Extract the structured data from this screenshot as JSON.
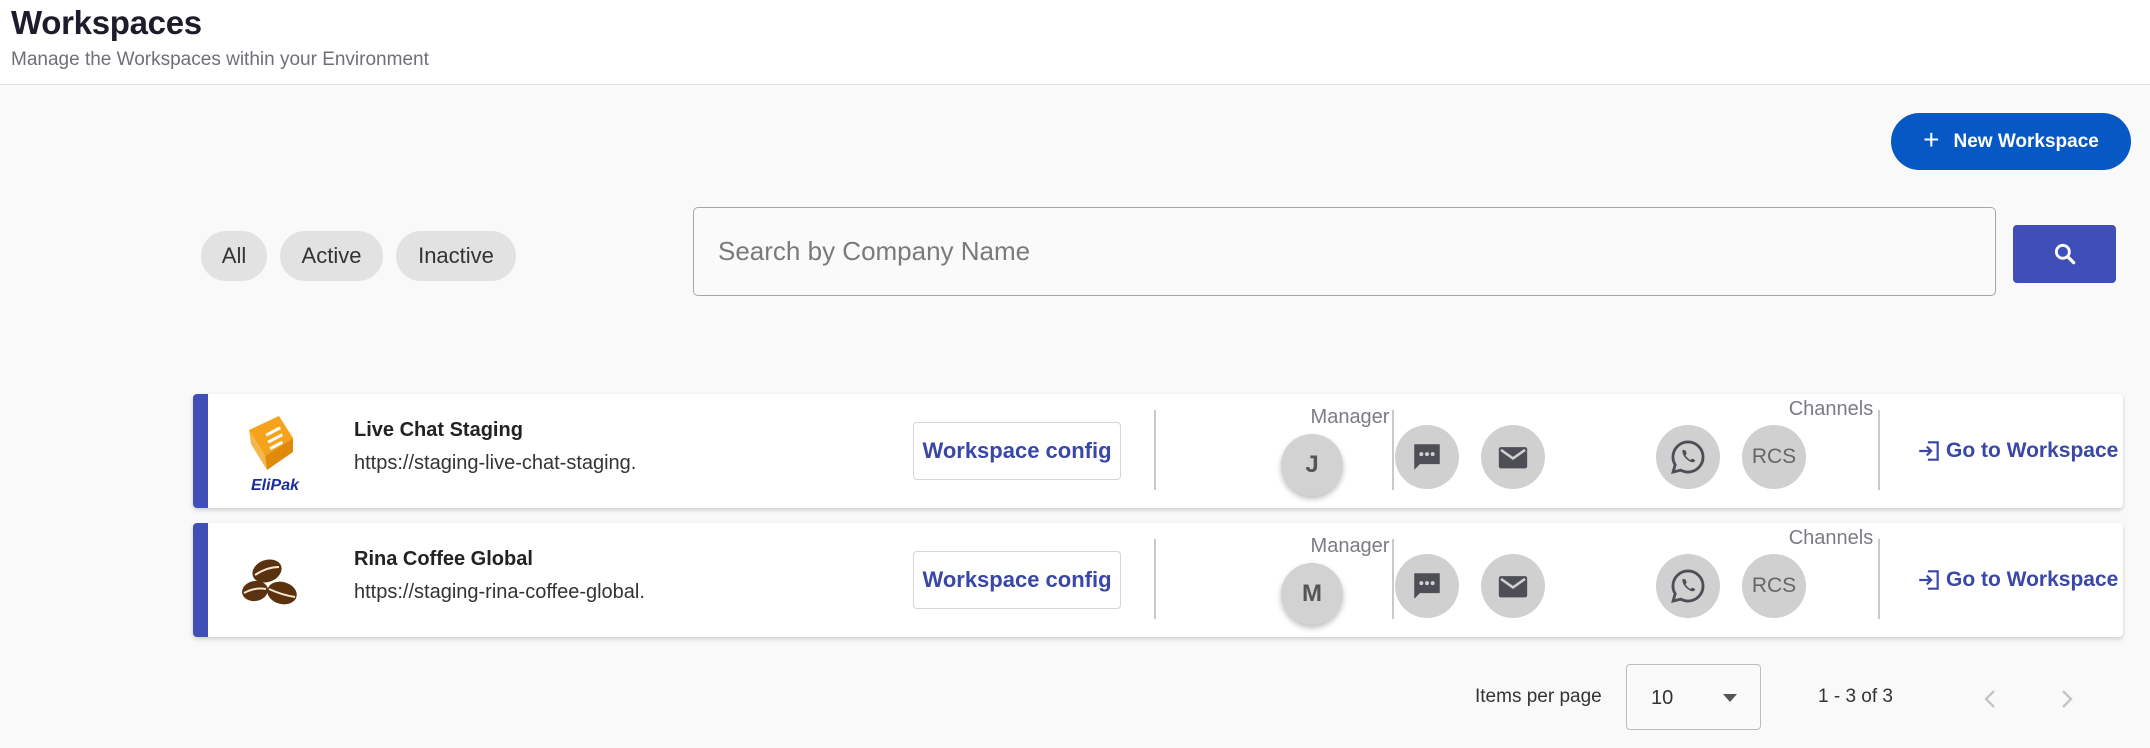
{
  "header": {
    "title": "Workspaces",
    "subtitle": "Manage the Workspaces within your Environment"
  },
  "toolbar": {
    "new_button_label": "New Workspace",
    "new_button_icon": "plus-icon"
  },
  "filters": [
    {
      "label": "All"
    },
    {
      "label": "Active"
    },
    {
      "label": "Inactive"
    }
  ],
  "search": {
    "placeholder": "Search by Company Name",
    "value": "",
    "button_icon": "search-icon"
  },
  "colors": {
    "primary": "#0658c4",
    "accent": "#3f4fb7",
    "link": "#3847a8"
  },
  "workspaces": [
    {
      "name": "Live Chat Staging",
      "url": "https://staging-live-chat-staging.",
      "logo": "elipak-logo",
      "logo_text": "EliPak",
      "config_label": "Workspace config",
      "manager_label": "Manager",
      "manager_initial": "J",
      "channels_label": "Channels",
      "channels": [
        "sms-icon",
        "email-icon",
        "whatsapp-icon",
        "RCS"
      ],
      "go_label": "Go to Workspace"
    },
    {
      "name": "Rina Coffee Global",
      "url": "https://staging-rina-coffee-global.",
      "logo": "coffee-beans-logo",
      "config_label": "Workspace config",
      "manager_label": "Manager",
      "manager_initial": "M",
      "channels_label": "Channels",
      "channels": [
        "sms-icon",
        "email-icon",
        "whatsapp-icon",
        "RCS"
      ],
      "go_label": "Go to Workspace"
    }
  ],
  "pagination": {
    "items_per_page_label": "Items per page",
    "items_per_page_value": "10",
    "range_text": "1 - 3 of 3"
  }
}
